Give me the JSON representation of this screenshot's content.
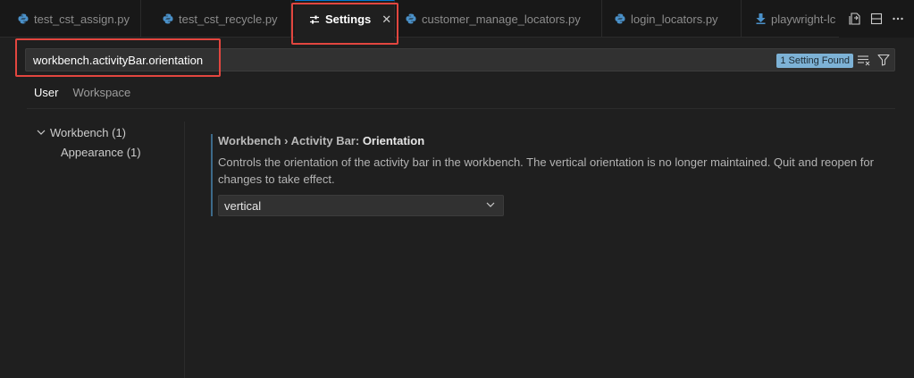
{
  "tabs": [
    {
      "label": "test_cst_assign.py"
    },
    {
      "label": "test_cst_recycle.py"
    },
    {
      "label": "Settings"
    },
    {
      "label": "customer_manage_locators.py"
    },
    {
      "label": "login_locators.py"
    },
    {
      "label": "playwright-lc"
    }
  ],
  "search": {
    "value": "workbench.activityBar.orientation",
    "result_badge": "1 Setting Found"
  },
  "scope_tabs": [
    "User",
    "Workspace"
  ],
  "toc": [
    {
      "label": "Workbench (1)"
    },
    {
      "label": "Appearance (1)"
    }
  ],
  "setting": {
    "category": "Workbench › Activity Bar: ",
    "name": "Orientation",
    "description": "Controls the orientation of the activity bar in the workbench. The vertical orientation is no longer maintained. Quit and reopen for changes to take effect.",
    "value": "vertical"
  },
  "colors": {
    "highlight": "#e2463f",
    "python_icon": "#4a90c8",
    "badge": "#7db2d6"
  }
}
